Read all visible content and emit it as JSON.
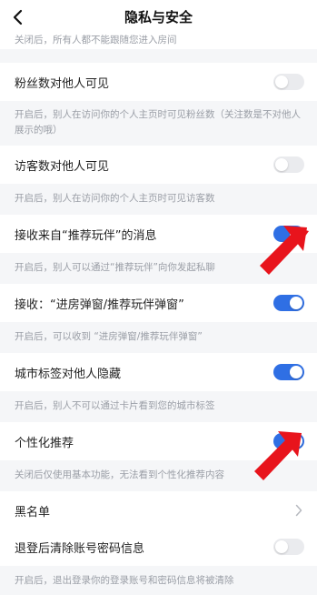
{
  "navbar": {
    "title": "隐私与安全",
    "back_icon": "chevron-left-icon"
  },
  "top_desc": "关闭后，所有人都不能跟随您进入房间",
  "rows": [
    {
      "label": "粉丝数对他人可见",
      "toggle": "off",
      "desc": "开启后，别人在访问你的个人主页时可见粉丝数（关注数是不对他人展示的哦）"
    },
    {
      "label": "访客数对他人可见",
      "toggle": "off",
      "desc": "开启后，别人在访问你的个人主页时可见访客数"
    },
    {
      "label": "接收来自“推荐玩伴”的消息",
      "toggle": "on",
      "desc": "开启后，别人可以通过“推荐玩伴”向你发起私聊"
    },
    {
      "label": "接收：“进房弹窗/推荐玩伴弹窗”",
      "toggle": "on",
      "desc": "开启后，可以收到 “进房弹窗/推荐玩伴弹窗”"
    },
    {
      "label": "城市标签对他人隐藏",
      "toggle": "on",
      "desc": "开启后，别人不可以通过卡片看到您的城市标签"
    },
    {
      "label": "个性化推荐",
      "toggle": "on",
      "desc": "关闭后仅使用基本功能，无法看到个性化推荐内容"
    },
    {
      "label": "黑名单",
      "chevron": "chevron-right-icon"
    },
    {
      "label": "退登后清除账号密码信息",
      "toggle": "off",
      "desc": "开启后，退出登录你的登录账号和密码信息将被清除"
    }
  ],
  "colors": {
    "accent": "#2f6fe4",
    "toggle_off": "#eaebee",
    "annotation_arrow": "#e8141c"
  }
}
